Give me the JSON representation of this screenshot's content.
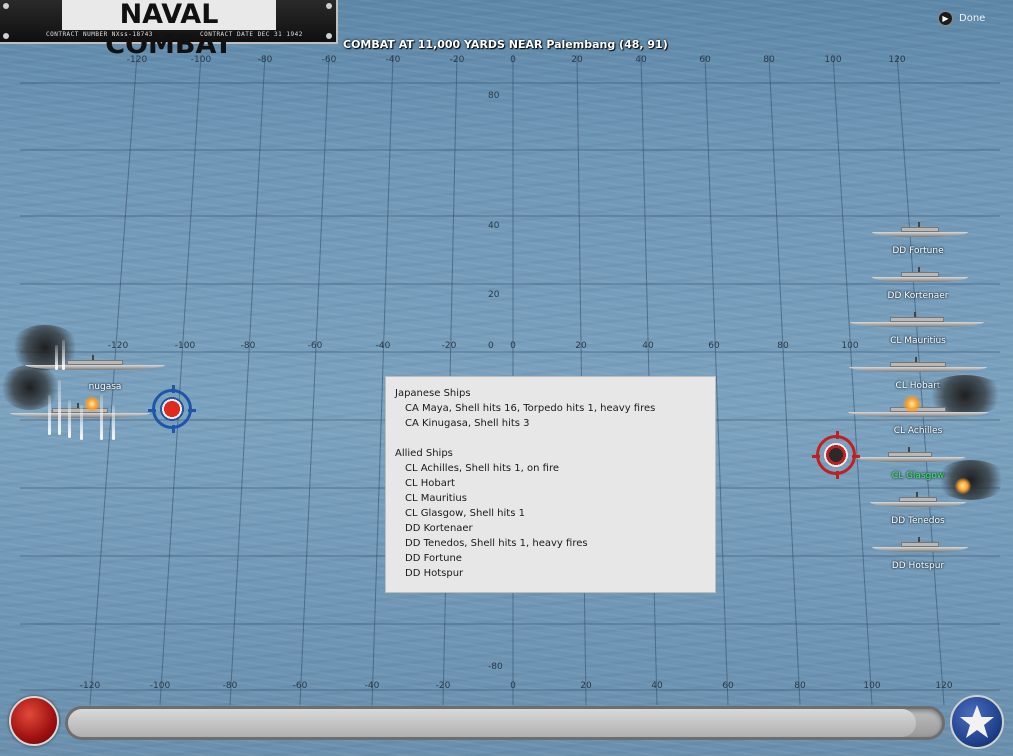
{
  "title_plate": {
    "title": "NAVAL COMBAT",
    "contract_number": "CONTRACT NUMBER  NXss-18743",
    "contract_date": "CONTRACT DATE  DEC 31 1942"
  },
  "header": {
    "combat_text": "COMBAT AT 11,000 YARDS NEAR Palembang (48, 91)",
    "done_label": "Done",
    "done_icon": "arrow-right-circle-icon"
  },
  "grid": {
    "top_x_labels": [
      "-120",
      "-100",
      "-80",
      "-60",
      "-40",
      "-20",
      "0",
      "20",
      "40",
      "60",
      "80",
      "100",
      "120"
    ],
    "mid_x_labels": [
      "-120",
      "-100",
      "-80",
      "-60",
      "-40",
      "-20",
      "0",
      "20",
      "40",
      "60",
      "80",
      "100"
    ],
    "bottom_x_labels": [
      "-120",
      "-100",
      "-80",
      "-60",
      "-40",
      "-20",
      "0",
      "20",
      "40",
      "60",
      "80",
      "100",
      "120"
    ],
    "y_labels": [
      "80",
      "40",
      "20",
      "0",
      "-80"
    ]
  },
  "japanese_fleet": {
    "visible_label": "nugasa"
  },
  "allied_fleet": [
    {
      "name": "DD Fortune"
    },
    {
      "name": "DD Kortenaer"
    },
    {
      "name": "CL Mauritius"
    },
    {
      "name": "CL Hobart"
    },
    {
      "name": "CL Achilles"
    },
    {
      "name": "CL Glasgow"
    },
    {
      "name": "DD Tenedos"
    },
    {
      "name": "DD Hotspur"
    }
  ],
  "report": {
    "japanese_header": "Japanese Ships",
    "japanese_lines": [
      "CA Maya, Shell hits 16, Torpedo hits 1,  heavy fires",
      "CA Kinugasa, Shell hits 3"
    ],
    "allied_header": "Allied Ships",
    "allied_lines": [
      "CL Achilles, Shell hits 1,  on fire",
      "CL Hobart",
      "CL Mauritius",
      "CL Glasgow, Shell hits 1",
      "DD Kortenaer",
      "DD Tenedos, Shell hits 1,  heavy fires",
      "DD Fortune",
      "DD Hotspur"
    ]
  },
  "bottom_bar": {
    "left_button_icon": "red-circle-button-icon",
    "right_button_icon": "allied-star-icon",
    "progress": 0.97
  },
  "colors": {
    "sea": "#7ba2bf",
    "grid_line": "#2f4a66",
    "active_ship_label": "#3df05a",
    "report_bg": "#e7e7e7"
  }
}
